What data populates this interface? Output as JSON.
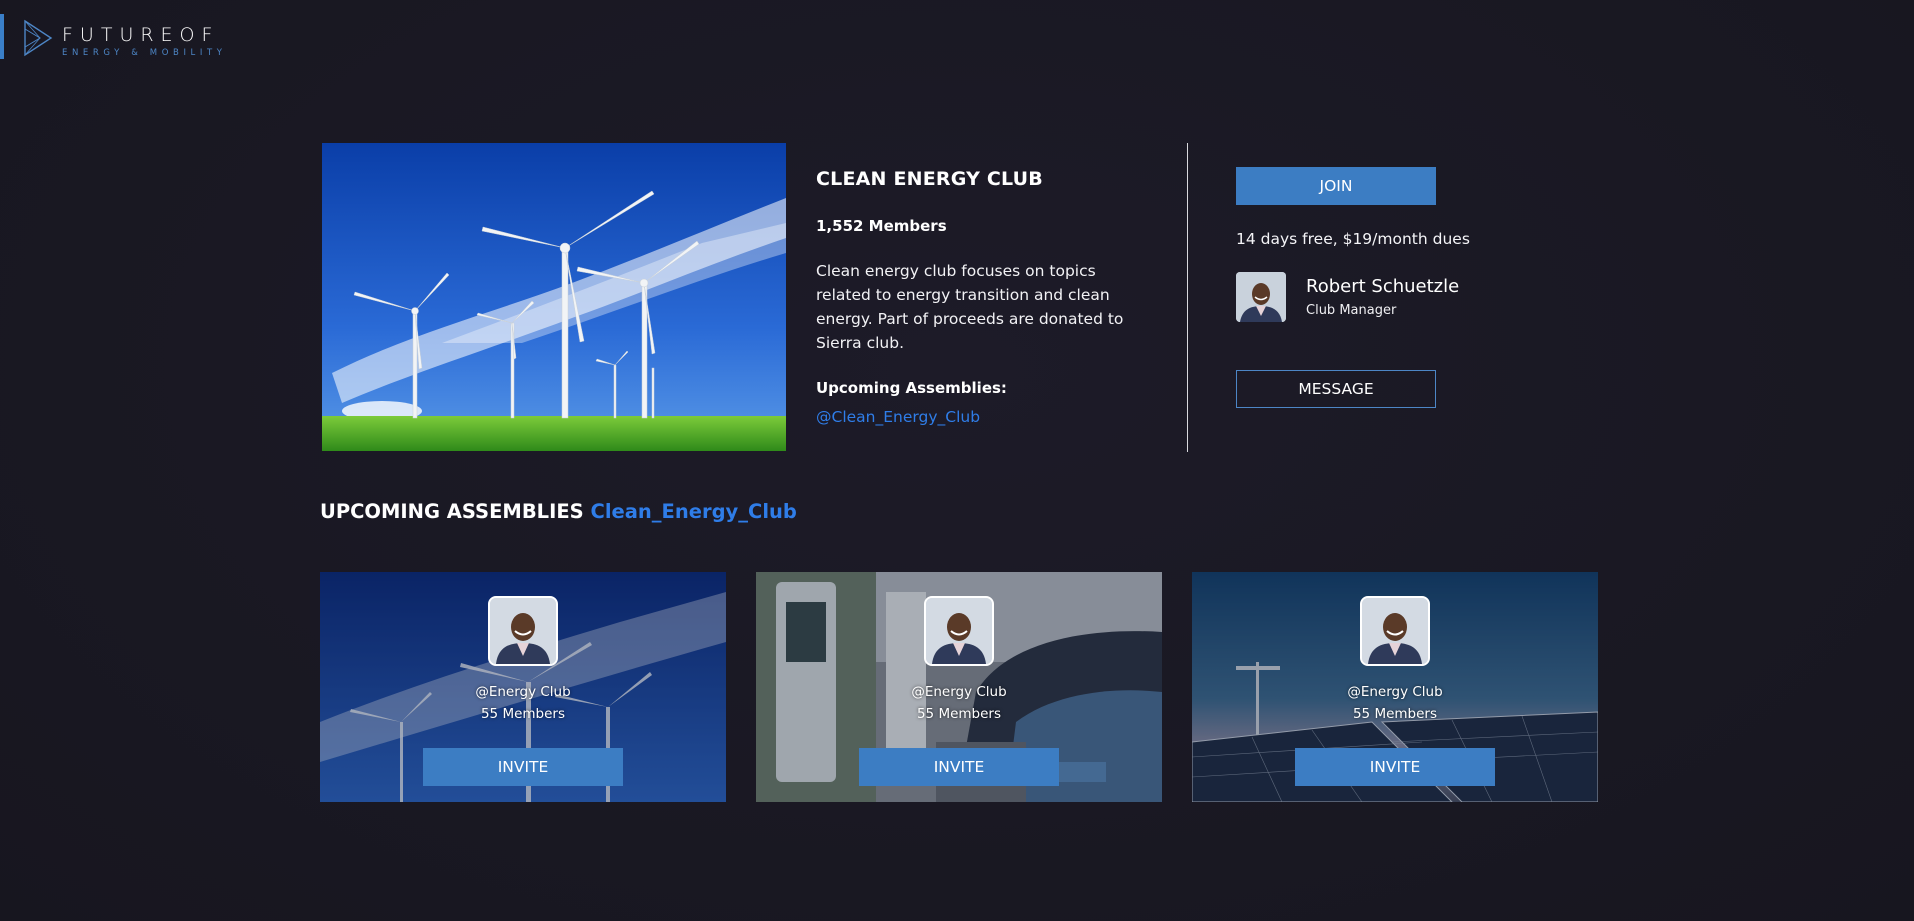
{
  "logo": {
    "main": "FUTUREOF",
    "sub": "ENERGY & MOBILITY"
  },
  "club": {
    "title": "CLEAN ENERGY CLUB",
    "members": "1,552 Members",
    "description": "Clean energy club focuses on topics related to energy transition and clean energy. Part of proceeds are donated to Sierra club.",
    "assemblies_label": "Upcoming Assemblies:",
    "assemblies_link": "@Clean_Energy_Club"
  },
  "sidebar": {
    "join_label": "JOIN",
    "dues": "14 days free, $19/month dues",
    "manager_name": "Robert Schuetzle",
    "manager_role": "Club Manager",
    "message_label": "MESSAGE"
  },
  "section": {
    "title": "UPCOMING ASSEMBLIES",
    "title_accent": "Clean_Energy_Club"
  },
  "cards": [
    {
      "name": "@Energy Club",
      "members": "55 Members",
      "invite_label": "INVITE",
      "background": "wind-turbines"
    },
    {
      "name": "@Energy Club",
      "members": "55 Members",
      "invite_label": "INVITE",
      "background": "ev-charging-station"
    },
    {
      "name": "@Energy Club",
      "members": "55 Members",
      "invite_label": "INVITE",
      "background": "solar-panels"
    }
  ],
  "colors": {
    "background": "#1a1824",
    "accent": "#3c7dc3",
    "link": "#2f7de8"
  }
}
